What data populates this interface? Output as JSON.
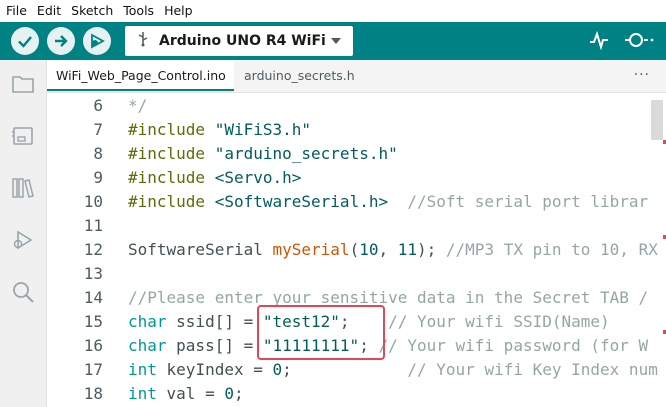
{
  "menu": [
    "File",
    "Edit",
    "Sketch",
    "Tools",
    "Help"
  ],
  "toolbar": {
    "board_name": "Arduino UNO R4 WiFi",
    "accent": "#008184"
  },
  "tabs": [
    "WiFi_Web_Page_Control.ino",
    "arduino_secrets.h"
  ],
  "more_label": "···",
  "editor": {
    "lines": [
      {
        "n": "6",
        "parts": [
          {
            "t": "*/",
            "c": "cm"
          }
        ]
      },
      {
        "n": "7",
        "parts": [
          {
            "t": "#include ",
            "c": "pp"
          },
          {
            "t": "\"WiFiS3.h\"",
            "c": "str"
          }
        ]
      },
      {
        "n": "8",
        "parts": [
          {
            "t": "#include ",
            "c": "pp"
          },
          {
            "t": "\"arduino_secrets.h\"",
            "c": "str"
          }
        ]
      },
      {
        "n": "9",
        "parts": [
          {
            "t": "#include ",
            "c": "pp"
          },
          {
            "t": "<Servo.h>",
            "c": "str"
          }
        ]
      },
      {
        "n": "10",
        "parts": [
          {
            "t": "#include ",
            "c": "pp"
          },
          {
            "t": "<SoftwareSerial.h>",
            "c": "str"
          },
          {
            "t": "  //Soft serial port librar",
            "c": "cm"
          }
        ]
      },
      {
        "n": "11",
        "parts": []
      },
      {
        "n": "12",
        "parts": [
          {
            "t": "SoftwareSerial ",
            "c": "txt"
          },
          {
            "t": "mySerial",
            "c": "fn"
          },
          {
            "t": "(",
            "c": "txt"
          },
          {
            "t": "10",
            "c": "num"
          },
          {
            "t": ", ",
            "c": "txt"
          },
          {
            "t": "11",
            "c": "num"
          },
          {
            "t": "); ",
            "c": "txt"
          },
          {
            "t": "//MP3 TX pin to 10, RX",
            "c": "cm"
          }
        ]
      },
      {
        "n": "13",
        "parts": []
      },
      {
        "n": "14",
        "parts": [
          {
            "t": "//Please enter your sensitive data in the Secret TAB /",
            "c": "cm"
          }
        ]
      },
      {
        "n": "15",
        "parts": [
          {
            "t": "char",
            "c": "kw"
          },
          {
            "t": " ssid[] = ",
            "c": "txt"
          },
          {
            "t": "\"test12\"",
            "c": "str"
          },
          {
            "t": ";    ",
            "c": "txt"
          },
          {
            "t": "// Your wifi SSID(Name)",
            "c": "cm"
          }
        ]
      },
      {
        "n": "16",
        "parts": [
          {
            "t": "char",
            "c": "kw"
          },
          {
            "t": " pass[] = ",
            "c": "txt"
          },
          {
            "t": "\"11111111\"",
            "c": "str"
          },
          {
            "t": "; ",
            "c": "txt"
          },
          {
            "t": "// Your wifi password (for W",
            "c": "cm"
          }
        ]
      },
      {
        "n": "17",
        "parts": [
          {
            "t": "int",
            "c": "kw"
          },
          {
            "t": " keyIndex = ",
            "c": "txt"
          },
          {
            "t": "0",
            "c": "num"
          },
          {
            "t": ";            ",
            "c": "txt"
          },
          {
            "t": "// Your wifi Key Index numbe",
            "c": "cm"
          }
        ]
      },
      {
        "n": "18",
        "parts": [
          {
            "t": "int",
            "c": "kw"
          },
          {
            "t": " val = ",
            "c": "txt"
          },
          {
            "t": "0",
            "c": "num"
          },
          {
            "t": ";",
            "c": "txt"
          }
        ]
      }
    ]
  }
}
